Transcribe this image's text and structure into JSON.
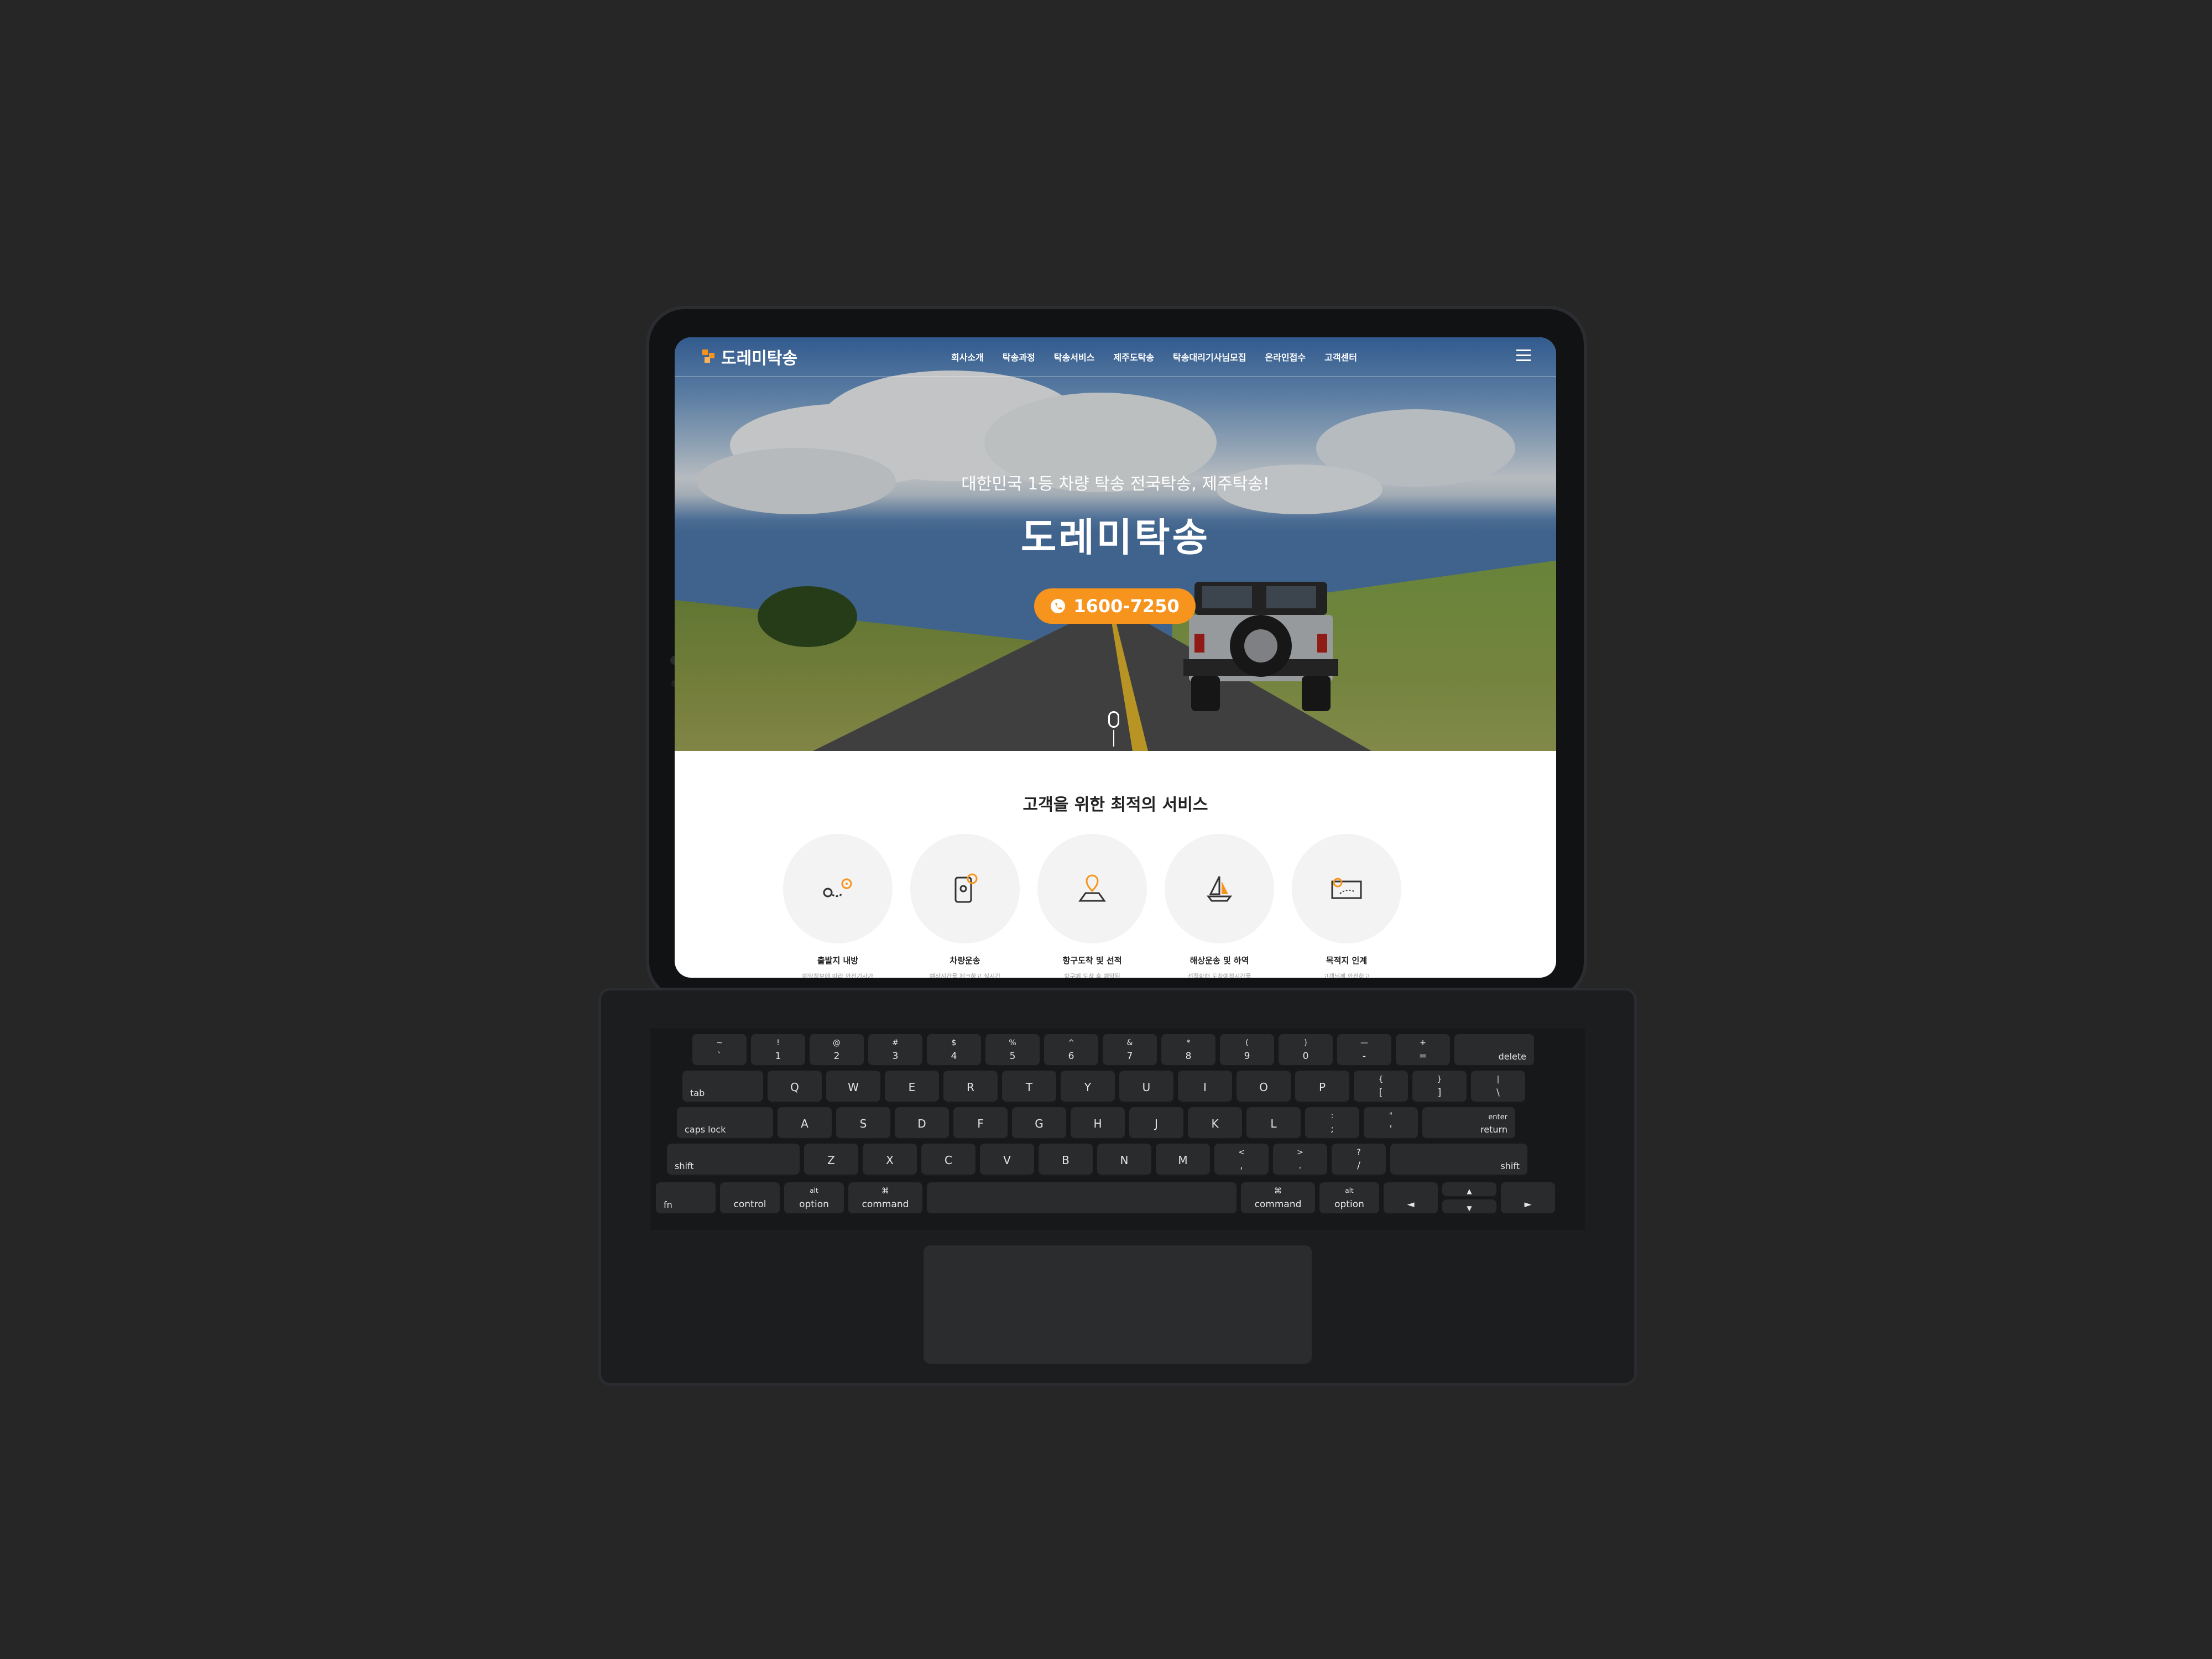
{
  "site": {
    "logo": "도레미탁송",
    "nav": [
      "회사소개",
      "탁송과정",
      "탁송서비스",
      "제주도탁송",
      "탁송대리기사님모집",
      "온라인접수",
      "고객센터"
    ],
    "hero": {
      "subtitle": "대한민국 1등 차량 탁송 전국탁송, 제주탁송!",
      "title": "도레미탁송",
      "phone": "1600-7250"
    },
    "section_title": "고객을 위한 최적의 서비스",
    "services": [
      {
        "label": "출발지 내방",
        "desc": "예약정보에 따라 안전기사가",
        "icon": "map-pin-route-icon"
      },
      {
        "label": "차량운송",
        "desc": "예상시간을 체크하고 실시간",
        "icon": "phone-location-icon"
      },
      {
        "label": "항구도착 및 선적",
        "desc": "항구에 도착 후 예약된",
        "icon": "map-pin-location-icon"
      },
      {
        "label": "해상운송 및 하역",
        "desc": "선적화해 도착예정시간을",
        "icon": "sailboat-icon"
      },
      {
        "label": "목적지 인계",
        "desc": "고객님께 안전하고",
        "icon": "map-route-icon"
      }
    ]
  },
  "keyboard": {
    "row1": [
      [
        "~",
        "`"
      ],
      [
        "!",
        "1"
      ],
      [
        "@",
        "2"
      ],
      [
        "#",
        "3"
      ],
      [
        "$",
        "4"
      ],
      [
        "%",
        "5"
      ],
      [
        "^",
        "6"
      ],
      [
        "&",
        "7"
      ],
      [
        "*",
        "8"
      ],
      [
        "(",
        "9"
      ],
      [
        ")",
        "0"
      ],
      [
        "—",
        "-"
      ],
      [
        "+",
        "="
      ]
    ],
    "delete": "delete",
    "tab": "tab",
    "row2": [
      "Q",
      "W",
      "E",
      "R",
      "T",
      "Y",
      "U",
      "I",
      "O",
      "P"
    ],
    "row2_sym": [
      [
        "{",
        "["
      ],
      [
        "}",
        "]"
      ],
      [
        "|",
        "\\"
      ]
    ],
    "capslock": "caps lock",
    "row3": [
      "A",
      "S",
      "D",
      "F",
      "G",
      "H",
      "J",
      "K",
      "L"
    ],
    "row3_sym": [
      [
        ":",
        ";"
      ],
      [
        "\"",
        "'"
      ]
    ],
    "enter_top": "enter",
    "return": "return",
    "shift": "shift",
    "row4": [
      "Z",
      "X",
      "C",
      "V",
      "B",
      "N",
      "M"
    ],
    "row4_sym": [
      [
        "<",
        ","
      ],
      [
        ">",
        "."
      ],
      [
        "?",
        "/"
      ]
    ],
    "fn": "fn",
    "control": "control",
    "alt": "alt",
    "option": "option",
    "cmd_symbol": "⌘",
    "command": "command",
    "arrows": [
      "◄",
      "▲",
      "▼",
      "►"
    ]
  }
}
